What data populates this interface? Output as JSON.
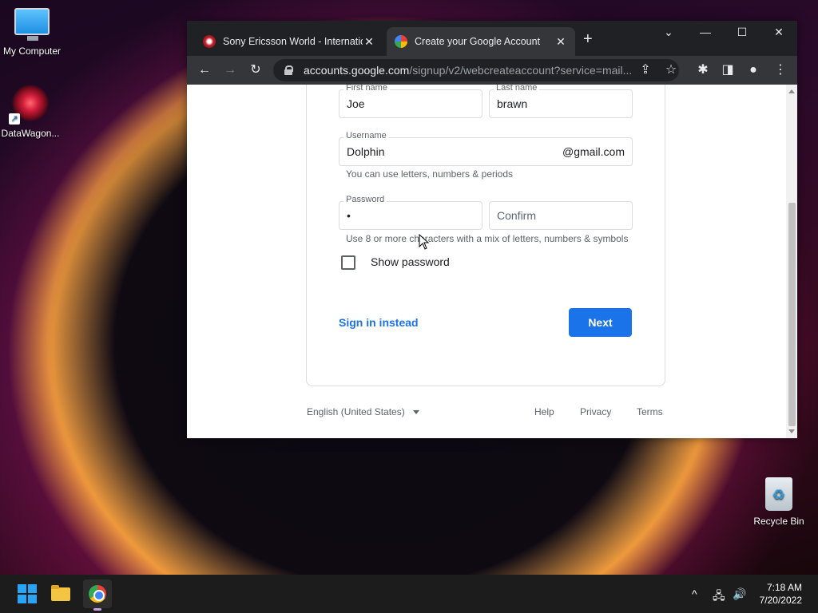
{
  "desktop": {
    "icons": [
      {
        "label": "My Computer"
      },
      {
        "label": "DataWagon..."
      },
      {
        "label": "Recycle Bin"
      }
    ]
  },
  "browser": {
    "tabs": [
      {
        "title": "Sony Ericsson World - Internation",
        "close": "✕"
      },
      {
        "title": "Create your Google Account",
        "close": "✕"
      }
    ],
    "new_tab": "+",
    "window_controls": {
      "dropdown": "⌄",
      "minimize": "—",
      "maximize": "☐",
      "close": "✕"
    },
    "toolbar": {
      "back": "←",
      "forward": "→",
      "reload": "↻",
      "url_host": "accounts.google.com",
      "url_path": "/signup/v2/webcreateaccount?service=mail...",
      "share": "⇪",
      "bookmark": "☆",
      "extensions": "✱",
      "sidepanel": "◨",
      "profile": "●",
      "menu": "⋮"
    }
  },
  "form": {
    "first_name": {
      "label": "First name",
      "value": "Joe"
    },
    "last_name": {
      "label": "Last name",
      "value": "brawn"
    },
    "username": {
      "label": "Username",
      "value": "Dolphin",
      "suffix": "@gmail.com"
    },
    "username_hint": "You can use letters, numbers & periods",
    "password": {
      "label": "Password",
      "value": "•"
    },
    "confirm": {
      "placeholder": "Confirm"
    },
    "password_hint": "Use 8 or more characters with a mix of letters, numbers & symbols",
    "show_password": "Show password",
    "sign_in": "Sign in instead",
    "next": "Next"
  },
  "footer": {
    "language": "English (United States)",
    "help": "Help",
    "privacy": "Privacy",
    "terms": "Terms"
  },
  "taskbar": {
    "tray": {
      "chevron": "^",
      "network": "🖧",
      "volume": "🔊"
    },
    "time": "7:18 AM",
    "date": "7/20/2022"
  }
}
